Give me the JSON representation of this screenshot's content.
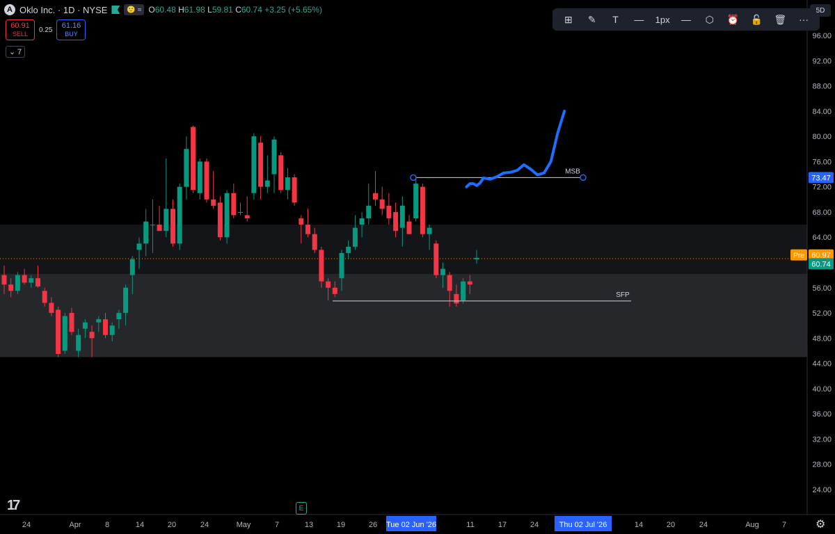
{
  "header": {
    "logo_letter": "A",
    "title": "Oklo Inc. · 1D · NYSE",
    "tags": [
      "🙂",
      "≈"
    ],
    "ohlc": [
      {
        "k": "O",
        "v": "60.48"
      },
      {
        "k": "H",
        "v": "61.98"
      },
      {
        "k": "L",
        "v": "59.81"
      },
      {
        "k": "C",
        "v": "60.74"
      }
    ],
    "change": "+3.25 (+5.65%)"
  },
  "trade": {
    "sell_price": "60.91",
    "sell_label": "SELL",
    "spread": "0.25",
    "buy_price": "61.16",
    "buy_label": "BUY"
  },
  "indicators_badge": "7",
  "toolbar": {
    "items": [
      {
        "name": "layout-icon",
        "glyph": "⊞"
      },
      {
        "name": "pencil-icon",
        "glyph": "✎"
      },
      {
        "name": "text-icon",
        "glyph": "T"
      },
      {
        "name": "line-style-icon",
        "glyph": "—"
      },
      {
        "name": "line-width-label",
        "glyph": "1px"
      },
      {
        "name": "dash-style-icon",
        "glyph": "—"
      },
      {
        "name": "settings-hex-icon",
        "glyph": "⬡"
      },
      {
        "name": "alarm-icon",
        "glyph": "⏰"
      },
      {
        "name": "unlock-icon",
        "glyph": "🔓"
      },
      {
        "name": "trash-icon",
        "glyph": "🗑"
      },
      {
        "name": "more-icon",
        "glyph": "···"
      }
    ]
  },
  "corner_label": "5D",
  "event_badge": "E",
  "tv_logo": "17",
  "chart_data": {
    "type": "candlestick",
    "ylim": [
      20,
      98
    ],
    "y_ticks": [
      24,
      28,
      32,
      36,
      40,
      44,
      48,
      52,
      56,
      60,
      64,
      68,
      72,
      76,
      80,
      84,
      88,
      92,
      96
    ],
    "x_labels": [
      "24",
      "Apr",
      "8",
      "14",
      "20",
      "24",
      "May",
      "7",
      "13",
      "19",
      "26",
      "11",
      "17",
      "24",
      "14",
      "20",
      "24",
      "Aug",
      "7"
    ],
    "x_highlights": [
      "Tue 02 Jun '26",
      "Thu 02 Jul '26"
    ],
    "price_labels": [
      {
        "text": "73.47",
        "value": 73.47,
        "color": "#2962ff"
      },
      {
        "text": "60.97",
        "value": 61.2,
        "color": "#ff9800",
        "prefix": "Pre"
      },
      {
        "text": "60.74",
        "value": 59.8,
        "color": "#089981"
      }
    ],
    "annotations": [
      {
        "label": "MSB",
        "value": 73.47
      },
      {
        "label": "SFP",
        "value": 53.9
      }
    ],
    "zones": [
      {
        "from": 58.2,
        "to": 66.0
      },
      {
        "from": 45.0,
        "to": 58.2
      }
    ],
    "candles": [
      [
        58.0,
        59.5,
        55.0,
        56.5
      ],
      [
        56.5,
        57.5,
        54.5,
        55.5
      ],
      [
        55.5,
        58.5,
        55.0,
        58.0
      ],
      [
        58.0,
        59.0,
        56.5,
        56.8
      ],
      [
        56.8,
        58.0,
        56.0,
        57.5
      ],
      [
        57.5,
        59.5,
        56.0,
        56.2
      ],
      [
        55.5,
        56.0,
        53.0,
        53.6
      ],
      [
        53.6,
        54.5,
        51.5,
        52.0
      ],
      [
        52.5,
        53.0,
        45.0,
        45.5
      ],
      [
        46.0,
        52.0,
        45.5,
        51.5
      ],
      [
        52.0,
        52.8,
        48.5,
        49.0
      ],
      [
        46.0,
        49.5,
        45.0,
        48.5
      ],
      [
        49.5,
        51.0,
        48.0,
        50.5
      ],
      [
        49.0,
        50.0,
        45.0,
        48.0
      ],
      [
        50.5,
        51.5,
        49.0,
        51.0
      ],
      [
        51.0,
        52.0,
        48.0,
        48.5
      ],
      [
        48.5,
        50.5,
        47.5,
        50.0
      ],
      [
        51.0,
        52.5,
        49.5,
        52.0
      ],
      [
        52.0,
        56.5,
        50.0,
        56.0
      ],
      [
        58.0,
        61.0,
        55.0,
        60.5
      ],
      [
        62.0,
        64.0,
        59.0,
        63.0
      ],
      [
        63.0,
        68.5,
        61.0,
        66.5
      ],
      [
        66.0,
        70.0,
        61.5,
        66.0
      ],
      [
        66.0,
        69.0,
        65.0,
        65.0
      ],
      [
        65.0,
        76.5,
        64.0,
        68.5
      ],
      [
        68.5,
        70.0,
        62.5,
        63.0
      ],
      [
        63.0,
        72.5,
        62.0,
        72.0
      ],
      [
        72.0,
        80.0,
        70.0,
        78.0
      ],
      [
        81.5,
        81.7,
        71.0,
        71.5
      ],
      [
        71.0,
        76.5,
        70.0,
        76.0
      ],
      [
        76.0,
        76.5,
        69.5,
        70.0
      ],
      [
        70.0,
        74.5,
        68.5,
        69.0
      ],
      [
        69.5,
        70.5,
        63.5,
        64.0
      ],
      [
        64.0,
        71.5,
        63.0,
        71.0
      ],
      [
        71.0,
        72.5,
        67.0,
        67.5
      ],
      [
        68.0,
        69.5,
        67.5,
        68.0
      ],
      [
        67.5,
        70.5,
        66.5,
        67.0
      ],
      [
        71.0,
        80.5,
        70.0,
        80.0
      ],
      [
        79.0,
        80.0,
        70.0,
        72.0
      ],
      [
        72.0,
        77.0,
        71.0,
        73.0
      ],
      [
        74.0,
        80.0,
        71.0,
        79.5
      ],
      [
        77.0,
        77.5,
        71.0,
        71.5
      ],
      [
        71.5,
        75.0,
        70.0,
        73.5
      ],
      [
        73.5,
        74.0,
        69.0,
        69.5
      ],
      [
        67.0,
        67.5,
        63.0,
        66.0
      ],
      [
        66.0,
        68.5,
        64.0,
        64.5
      ],
      [
        64.5,
        65.5,
        61.5,
        62.0
      ],
      [
        62.0,
        62.5,
        56.0,
        57.0
      ],
      [
        57.0,
        57.5,
        54.0,
        56.0
      ],
      [
        56.0,
        57.0,
        54.5,
        55.0
      ],
      [
        57.5,
        62.0,
        55.5,
        61.5
      ],
      [
        61.5,
        63.5,
        60.5,
        62.5
      ],
      [
        62.5,
        67.5,
        62.0,
        65.5
      ],
      [
        66.0,
        68.0,
        64.0,
        67.0
      ],
      [
        67.0,
        72.5,
        66.0,
        69.0
      ],
      [
        71.0,
        74.5,
        69.0,
        70.0
      ],
      [
        70.0,
        72.0,
        67.5,
        68.5
      ],
      [
        69.0,
        71.0,
        66.0,
        67.0
      ],
      [
        68.0,
        69.5,
        64.0,
        65.0
      ],
      [
        65.5,
        70.5,
        62.5,
        69.0
      ],
      [
        66.5,
        67.5,
        64.5,
        64.5
      ],
      [
        67.0,
        73.5,
        66.5,
        72.5
      ],
      [
        72.0,
        72.5,
        64.0,
        64.5
      ],
      [
        64.5,
        66.0,
        62.0,
        65.5
      ],
      [
        63.0,
        63.5,
        57.5,
        58.0
      ],
      [
        58.0,
        60.0,
        56.0,
        59.0
      ],
      [
        58.0,
        58.5,
        53.0,
        55.5
      ],
      [
        55.0,
        56.5,
        53.0,
        53.5
      ],
      [
        54.0,
        57.5,
        53.5,
        57.0
      ],
      [
        57.0,
        58.0,
        55.0,
        56.5
      ],
      [
        60.5,
        61.98,
        59.81,
        60.74
      ]
    ],
    "drawn_path": [
      [
        68.5,
        72.0
      ],
      [
        69.0,
        72.5
      ],
      [
        69.5,
        72.5
      ],
      [
        70.0,
        72.2
      ],
      [
        70.5,
        72.6
      ],
      [
        71.0,
        73.4
      ],
      [
        72.0,
        73.2
      ],
      [
        73.0,
        73.6
      ],
      [
        74.0,
        74.2
      ],
      [
        75.0,
        74.3
      ],
      [
        76.0,
        74.6
      ],
      [
        77.0,
        75.5
      ],
      [
        78.0,
        74.8
      ],
      [
        79.0,
        73.9
      ],
      [
        80.0,
        74.2
      ],
      [
        81.0,
        76.0
      ],
      [
        82.0,
        80.5
      ],
      [
        83.0,
        84.0
      ]
    ]
  }
}
